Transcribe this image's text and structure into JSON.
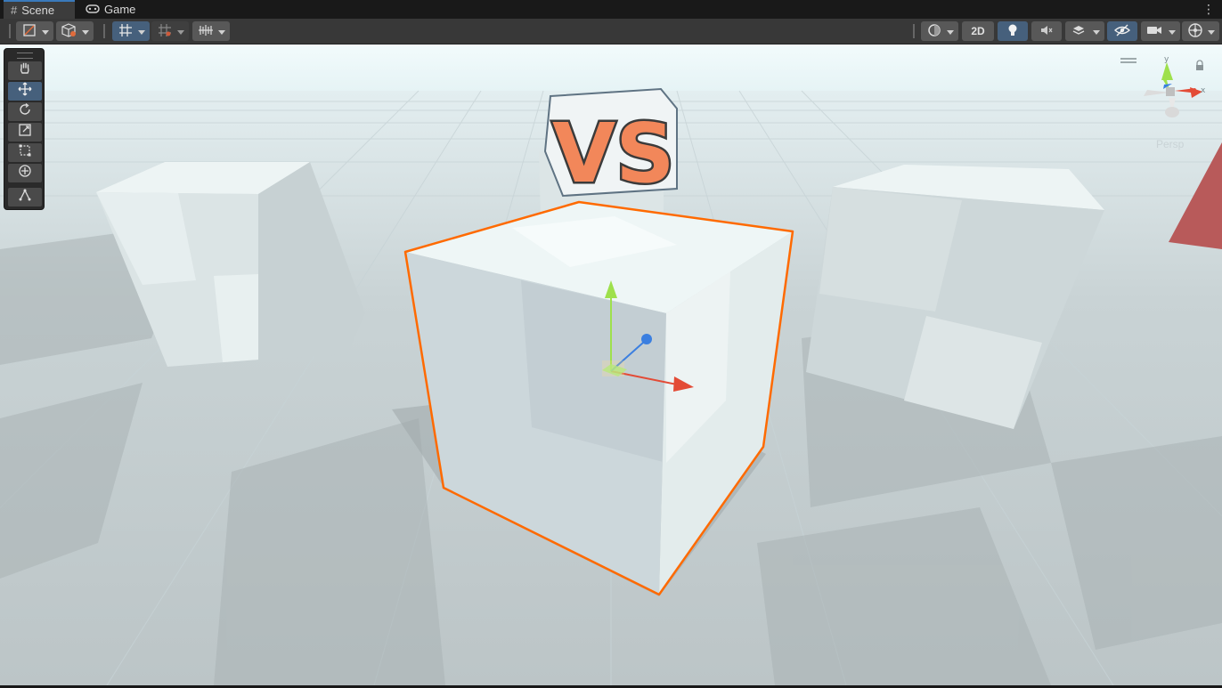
{
  "tabs": [
    {
      "label": "Scene",
      "icon": "grid-hash-icon",
      "active": true
    },
    {
      "label": "Game",
      "icon": "gamepad-icon",
      "active": false
    }
  ],
  "toolbar": {
    "left": [
      {
        "name": "draw-mode-dropdown",
        "icon": "draw-mode-icon"
      },
      {
        "name": "render-mode-dropdown",
        "icon": "cube-render-icon"
      },
      {
        "name": "grid-toggle",
        "icon": "grid-snap-icon",
        "active": true
      },
      {
        "name": "snap-increment-dropdown",
        "icon": "increment-snap-icon"
      },
      {
        "name": "align-dropdown",
        "icon": "align-icon"
      }
    ],
    "right": [
      {
        "name": "shading-dropdown",
        "icon": "sphere-icon"
      },
      {
        "name": "2d-toggle",
        "label": "2D"
      },
      {
        "name": "lighting-toggle",
        "icon": "lightbulb-icon",
        "active": true
      },
      {
        "name": "audio-toggle",
        "icon": "speaker-muted-icon"
      },
      {
        "name": "effects-dropdown",
        "icon": "layers-icon"
      },
      {
        "name": "visibility-toggle",
        "icon": "eye-crossed-icon",
        "active": true
      },
      {
        "name": "camera-dropdown",
        "icon": "camera-icon"
      },
      {
        "name": "gizmos-dropdown",
        "icon": "gizmo-globe-icon"
      }
    ]
  },
  "tools": [
    {
      "name": "hand-tool",
      "icon": "hand-icon"
    },
    {
      "name": "move-tool",
      "icon": "move-arrows-icon",
      "active": true
    },
    {
      "name": "rotate-tool",
      "icon": "rotate-icon"
    },
    {
      "name": "scale-tool",
      "icon": "scale-icon"
    },
    {
      "name": "rect-tool",
      "icon": "rect-transform-icon"
    },
    {
      "name": "transform-tool",
      "icon": "transform-icon"
    },
    {
      "name": "custom-tool",
      "icon": "custom-editor-icon"
    }
  ],
  "scene": {
    "camera_label": "Persp",
    "logo_text": "VS",
    "selection_color": "#ff6a00",
    "axis_colors": {
      "x": "#e34b36",
      "y": "#9ee04c",
      "z": "#3b7fe0"
    }
  }
}
